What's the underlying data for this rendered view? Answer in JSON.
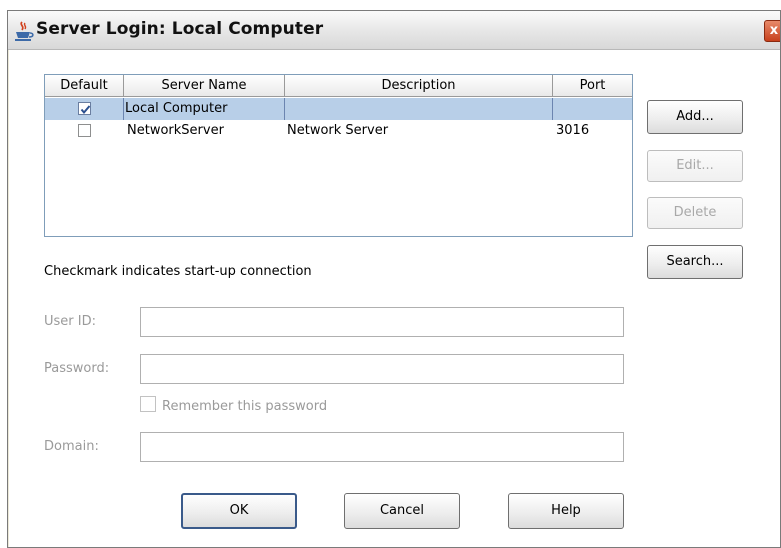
{
  "window": {
    "title": "Server Login: Local Computer",
    "close_label": "x"
  },
  "table": {
    "columns": [
      "Default",
      "Server Name",
      "Description",
      "Port"
    ],
    "rows": [
      {
        "default": true,
        "server_name": "Local Computer",
        "description": "",
        "port": "",
        "selected": true
      },
      {
        "default": false,
        "server_name": "NetworkServer",
        "description": "Network Server",
        "port": "3016",
        "selected": false
      }
    ]
  },
  "side_buttons": {
    "add": "Add...",
    "edit": "Edit...",
    "delete": "Delete",
    "search": "Search..."
  },
  "hint": "Checkmark indicates start-up connection",
  "form": {
    "user_id_label": "User ID:",
    "user_id_value": "",
    "password_label": "Password:",
    "password_value": "",
    "remember_label": "Remember this password",
    "remember_checked": false,
    "domain_label": "Domain:",
    "domain_value": ""
  },
  "bottom_buttons": {
    "ok": "OK",
    "cancel": "Cancel",
    "help": "Help"
  },
  "colors": {
    "selection": "#b8cfe8",
    "grid_border": "#7f9db9",
    "disabled_text": "#9a9a9a"
  }
}
